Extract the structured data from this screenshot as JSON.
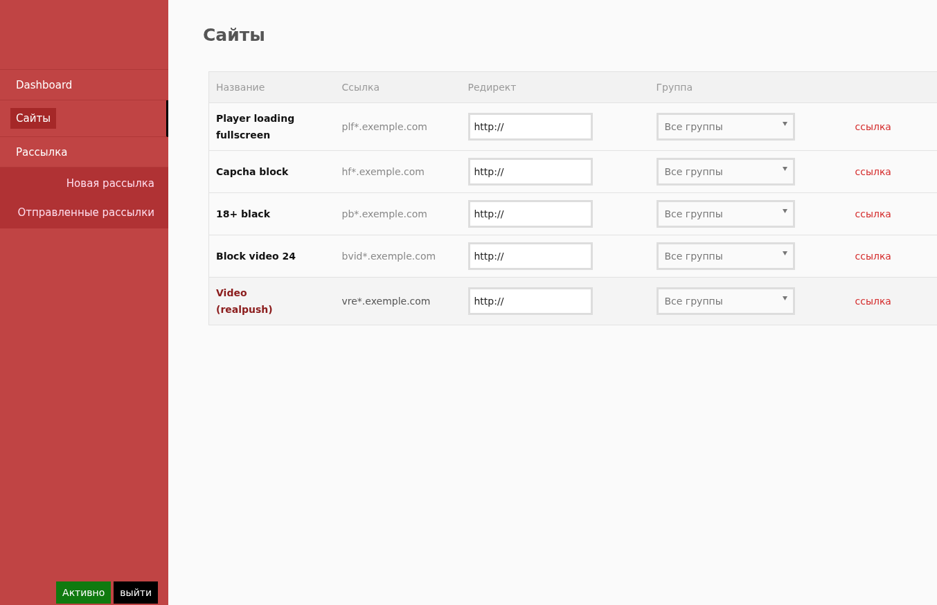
{
  "sidebar": {
    "items": [
      {
        "label": "Dashboard",
        "selected": false
      },
      {
        "label": "Сайты",
        "selected": true
      },
      {
        "label": "Рассылка",
        "selected": false,
        "children": [
          {
            "label": "Новая рассылка",
            "selected": false
          },
          {
            "label": "Отправленные рассылки",
            "selected": false
          }
        ]
      }
    ],
    "status_button": "Активно",
    "logout_button": "выйти"
  },
  "page": {
    "title": "Сайты"
  },
  "table": {
    "columns": [
      "Название",
      "Ссылка",
      "Редирект",
      "Группа"
    ],
    "rows": [
      {
        "name": "Player loading fullscreen",
        "link": "plf*.exemple.com",
        "redirect": "http://",
        "group": "Все группы",
        "action": "ссылка",
        "selected": false
      },
      {
        "name": "Capcha block",
        "link": "hf*.exemple.com",
        "redirect": "http://",
        "group": "Все группы",
        "action": "ссылка",
        "selected": false
      },
      {
        "name": "18+ black",
        "link": "pb*.exemple.com",
        "redirect": "http://",
        "group": "Все группы",
        "action": "ссылка",
        "selected": false
      },
      {
        "name": "Block video 24",
        "link": "bvid*.exemple.com",
        "redirect": "http://",
        "group": "Все группы",
        "action": "ссылка",
        "selected": false
      },
      {
        "name": "Video (realpush)",
        "link": "vre*.exemple.com",
        "redirect": "http://",
        "group": "Все группы",
        "action": "ссылка",
        "selected": true
      }
    ]
  }
}
